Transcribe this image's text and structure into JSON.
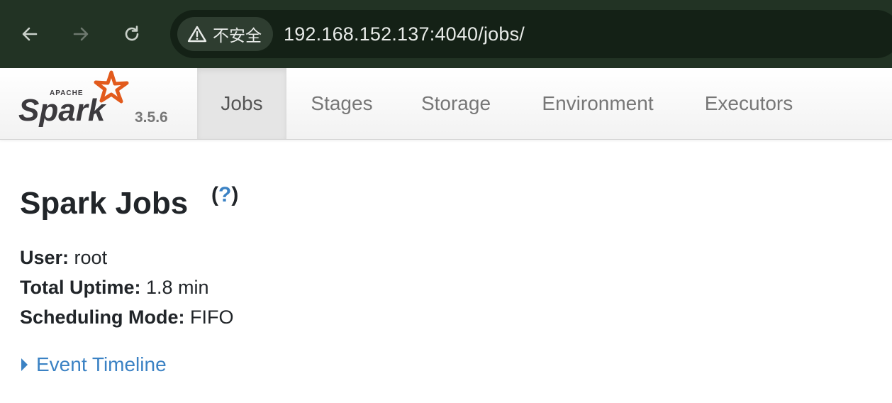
{
  "browser": {
    "security_label": "不安全",
    "url": "192.168.152.137:4040/jobs/",
    "icons": [
      "back-arrow-icon",
      "forward-arrow-icon",
      "reload-icon",
      "warning-icon"
    ]
  },
  "navbar": {
    "brand_version": "3.5.6",
    "tabs": [
      {
        "label": "Jobs",
        "active": true
      },
      {
        "label": "Stages",
        "active": false
      },
      {
        "label": "Storage",
        "active": false
      },
      {
        "label": "Environment",
        "active": false
      },
      {
        "label": "Executors",
        "active": false
      }
    ]
  },
  "page": {
    "title": "Spark Jobs",
    "help": "?",
    "info": [
      {
        "label": "User:",
        "value": "root"
      },
      {
        "label": "Total Uptime:",
        "value": "1.8 min"
      },
      {
        "label": "Scheduling Mode:",
        "value": "FIFO"
      }
    ],
    "timeline_label": "Event Timeline"
  },
  "colors": {
    "chrome_bg": "#223324",
    "link": "#3b82c4",
    "spark_orange": "#e25a1c"
  }
}
